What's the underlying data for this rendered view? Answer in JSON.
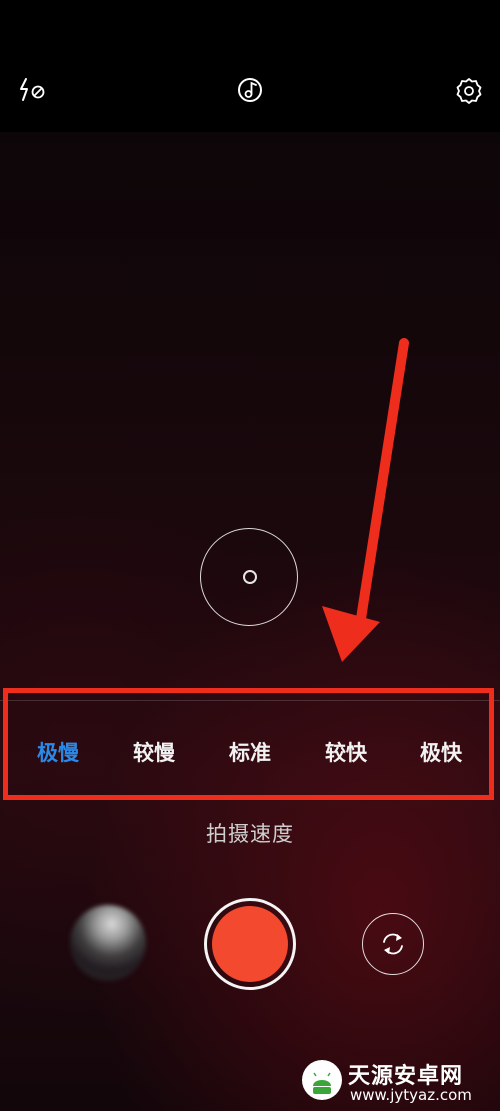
{
  "top_bar": {
    "flash_icon": "flash-off-icon",
    "music_icon": "music-note-icon",
    "settings_icon": "gear-icon"
  },
  "viewfinder": {
    "focus_icon": "focus-target-icon"
  },
  "speed_selector": {
    "options": [
      {
        "label": "极慢",
        "active": true
      },
      {
        "label": "较慢",
        "active": false
      },
      {
        "label": "标准",
        "active": false
      },
      {
        "label": "较快",
        "active": false
      },
      {
        "label": "极快",
        "active": false
      }
    ],
    "caption": "拍摄速度",
    "active_color": "#2b8ae8"
  },
  "annotation": {
    "color": "#ee2d1d"
  },
  "bottom_controls": {
    "gallery_icon": "gallery-thumbnail",
    "shutter_color": "#f2492f",
    "flip_icon": "camera-flip-icon"
  },
  "watermark": {
    "title": "天源安卓网",
    "url": "www.jytyaz.com"
  }
}
